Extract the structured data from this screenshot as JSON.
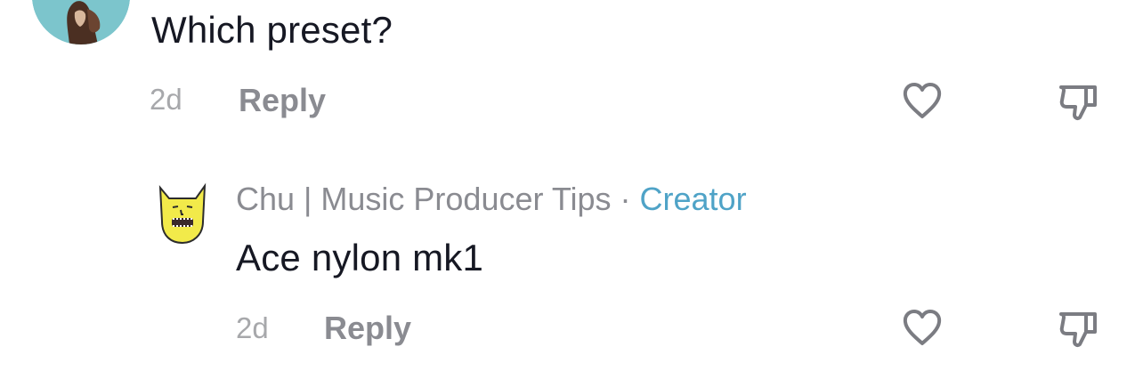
{
  "comment": {
    "text": "Which preset?",
    "time": "2d",
    "reply_label": "Reply",
    "avatar_color": "#7cc5cc"
  },
  "reply": {
    "username": "Chu | Music Producer Tips",
    "separator": "·",
    "creator_badge": "Creator",
    "text": "Ace nylon mk1",
    "time": "2d",
    "reply_label": "Reply",
    "avatar_color": "#f2ea4a"
  },
  "icons": {
    "like": "heart-outline-icon",
    "dislike": "thumbs-down-outline-icon"
  },
  "colors": {
    "text_primary": "#161823",
    "text_secondary": "#8a8b91",
    "timestamp": "#a7a8ab",
    "creator_accent": "#4fa3c7"
  }
}
